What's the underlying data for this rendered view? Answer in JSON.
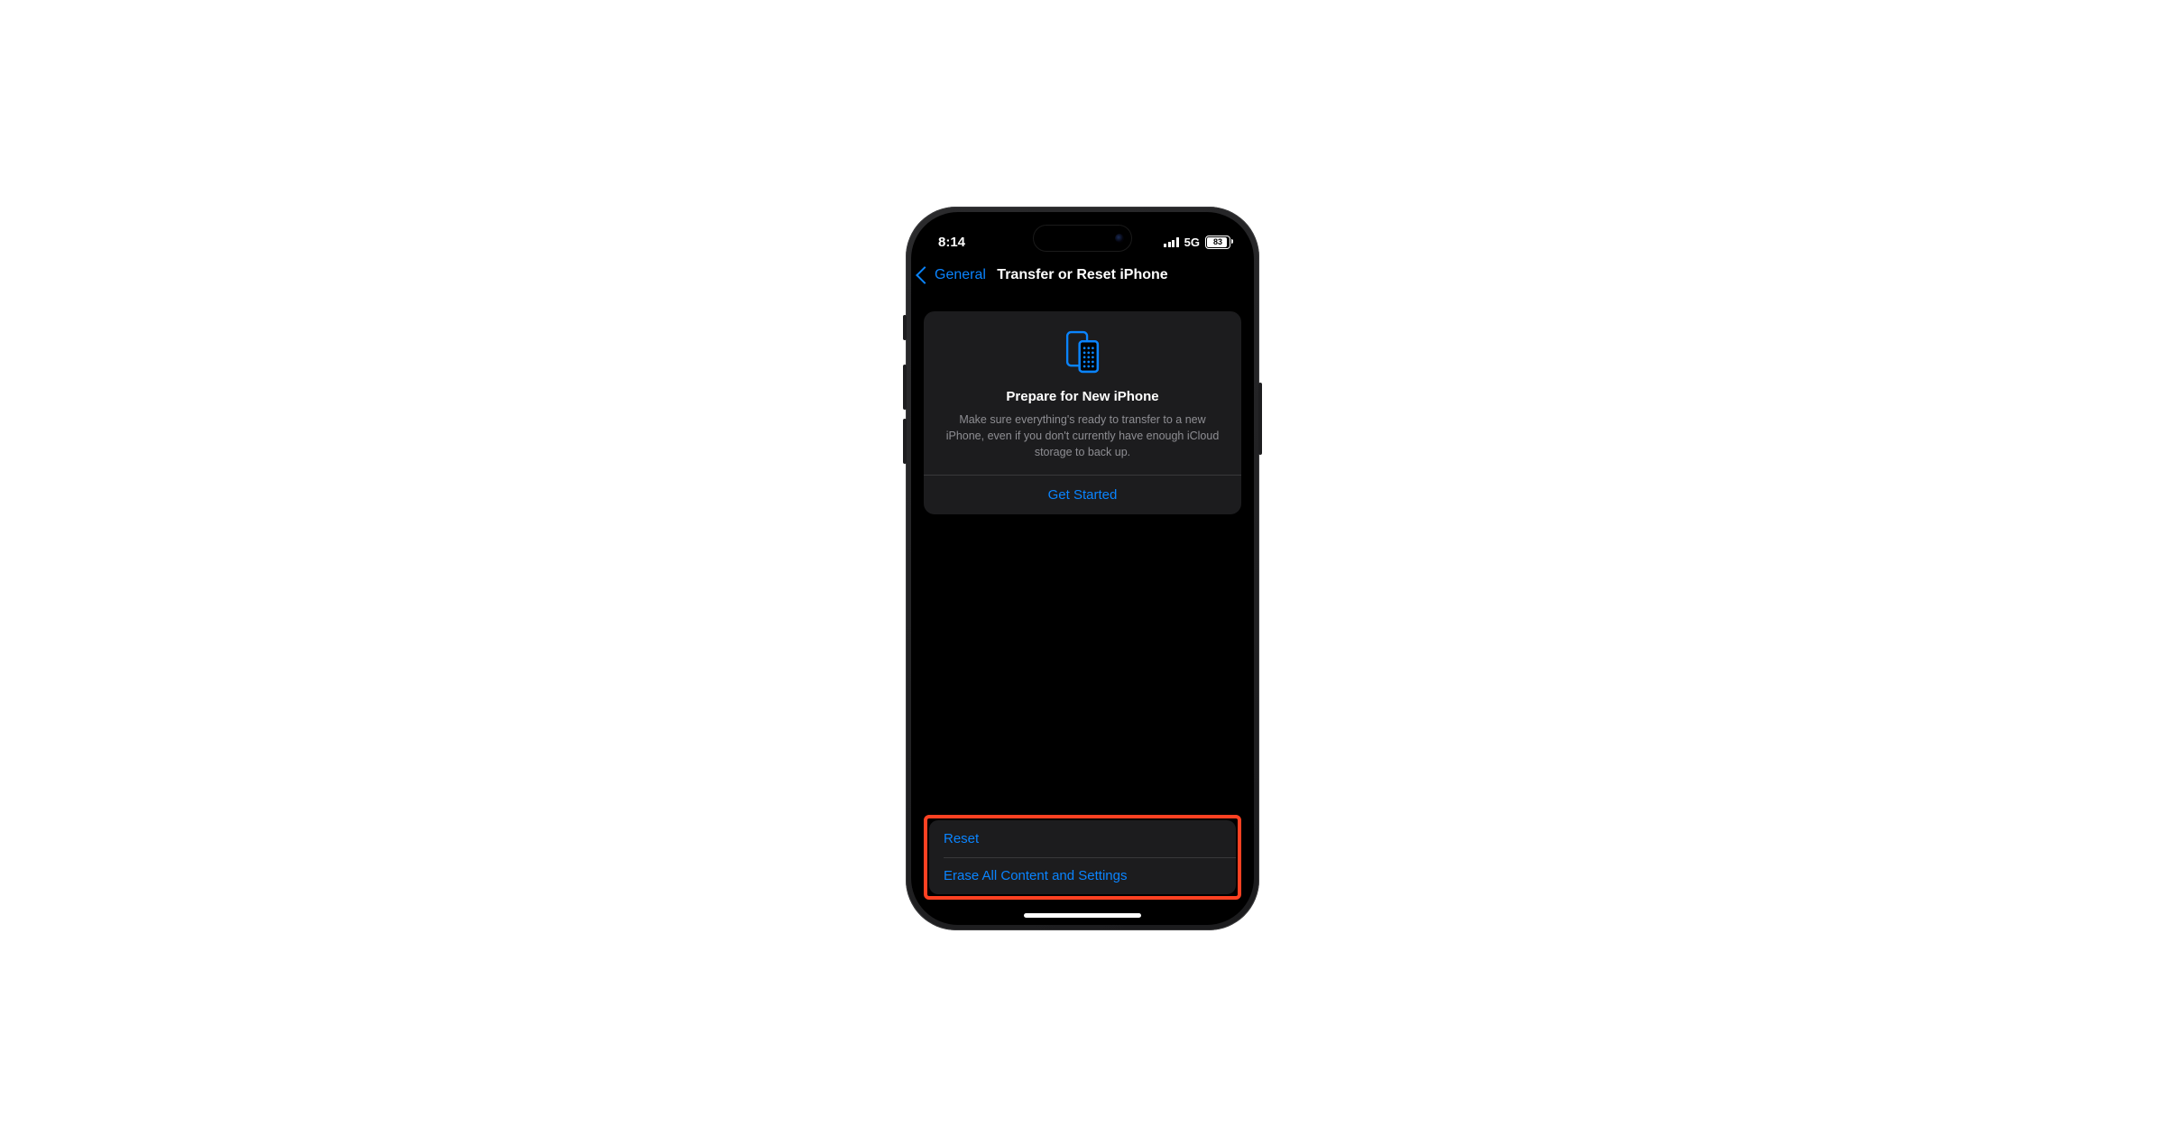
{
  "status": {
    "time": "8:14",
    "network": "5G",
    "battery": "83"
  },
  "nav": {
    "back": "General",
    "title": "Transfer or Reset iPhone"
  },
  "card": {
    "title": "Prepare for New iPhone",
    "desc": "Make sure everything's ready to transfer to a new iPhone, even if you don't currently have enough iCloud storage to back up.",
    "action": "Get Started"
  },
  "list": {
    "reset": "Reset",
    "erase": "Erase All Content and Settings"
  }
}
